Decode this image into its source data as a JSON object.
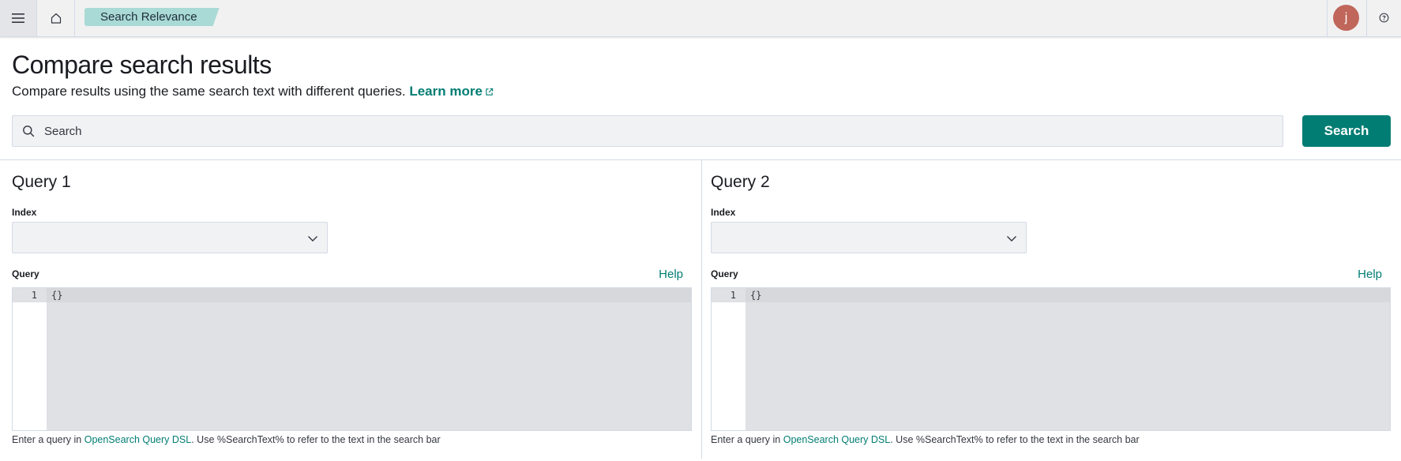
{
  "header": {
    "menu_icon": "hamburger-menu-icon",
    "home_icon": "home-icon",
    "breadcrumb": "Search Relevance",
    "avatar_initial": "j",
    "help_icon": "help-circle-icon"
  },
  "page": {
    "title": "Compare search results",
    "description": "Compare results using the same search text with different queries.",
    "learn_more": "Learn more"
  },
  "search": {
    "placeholder": "Search",
    "value": "",
    "button_label": "Search"
  },
  "queries": [
    {
      "title": "Query 1",
      "index_label": "Index",
      "index_value": "",
      "query_label": "Query",
      "help_label": "Help",
      "editor_line_no": "1",
      "editor_content": "{}",
      "hint_prefix": "Enter a query in ",
      "hint_link": "OpenSearch Query DSL",
      "hint_suffix": ". Use %SearchText% to refer to the text in the search bar"
    },
    {
      "title": "Query 2",
      "index_label": "Index",
      "index_value": "",
      "query_label": "Query",
      "help_label": "Help",
      "editor_line_no": "1",
      "editor_content": "{}",
      "hint_prefix": "Enter a query in ",
      "hint_link": "OpenSearch Query DSL",
      "hint_suffix": ". Use %SearchText% to refer to the text in the search bar"
    }
  ],
  "colors": {
    "accent": "#017d73",
    "breadcrumb_bg": "#a9dad5",
    "avatar_bg": "#c0665a"
  }
}
